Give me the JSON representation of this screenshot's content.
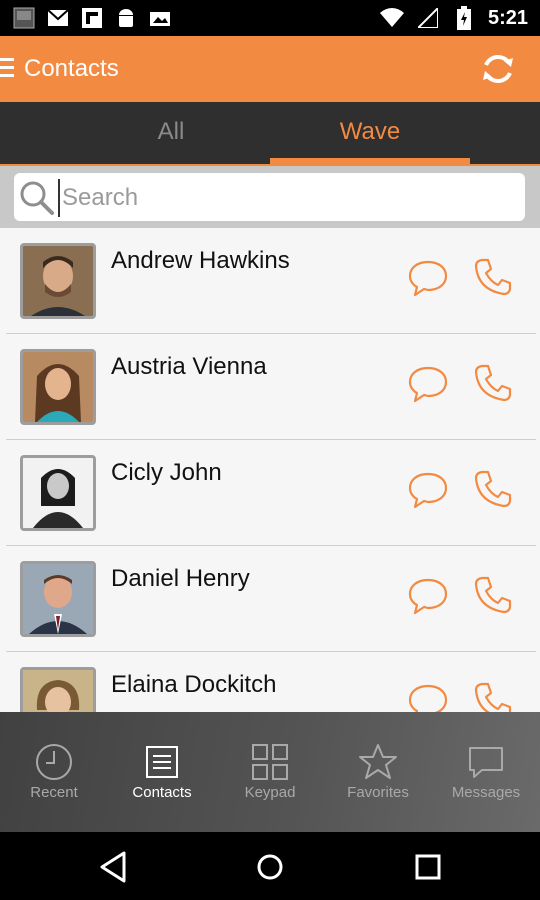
{
  "status_bar": {
    "time": "5:21"
  },
  "app_bar": {
    "title": "Contacts"
  },
  "tabs": [
    {
      "label": "All",
      "active": false
    },
    {
      "label": "Wave",
      "active": true
    }
  ],
  "search": {
    "placeholder": "Search",
    "value": ""
  },
  "contacts": [
    {
      "name": "Andrew Hawkins"
    },
    {
      "name": "Austria Vienna"
    },
    {
      "name": "Cicly John"
    },
    {
      "name": "Daniel Henry"
    },
    {
      "name": "Elaina Dockitch"
    }
  ],
  "bottom_nav": [
    {
      "label": "Recent",
      "icon": "clock-icon",
      "active": false
    },
    {
      "label": "Contacts",
      "icon": "contacts-list-icon",
      "active": true
    },
    {
      "label": "Keypad",
      "icon": "keypad-grid-icon",
      "active": false
    },
    {
      "label": "Favorites",
      "icon": "star-icon",
      "active": false
    },
    {
      "label": "Messages",
      "icon": "message-bubble-icon",
      "active": false
    }
  ],
  "colors": {
    "accent": "#f38a42",
    "tab_bar": "#2f2f2f",
    "status_bar": "#000000"
  }
}
